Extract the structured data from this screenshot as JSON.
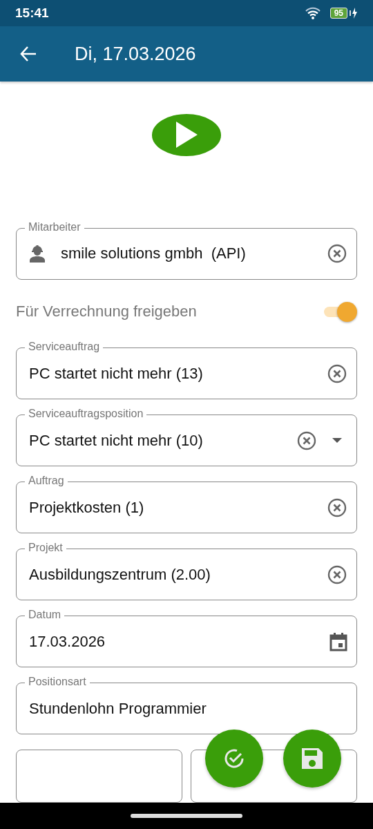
{
  "status_bar": {
    "time": "15:41",
    "battery": "95"
  },
  "app_bar": {
    "title": "Di, 17.03.2026"
  },
  "employee": {
    "label": "Mitarbeiter",
    "value": "smile solutions gmbh  (API)",
    "kind": "person"
  },
  "release": {
    "label": "Für Verrechnung freigeben",
    "on": true
  },
  "fields": [
    {
      "label": "Serviceauftrag",
      "value": "PC startet nicht mehr (13)",
      "kind": "clearable"
    },
    {
      "label": "Serviceauftragsposition",
      "value": "PC startet nicht mehr (10)",
      "kind": "dropdown"
    },
    {
      "label": "Auftrag",
      "value": "Projektkosten (1)",
      "kind": "clearable"
    },
    {
      "label": "Projekt",
      "value": "Ausbildungszentrum (2.00)",
      "kind": "clearable"
    },
    {
      "label": "Datum",
      "value": "17.03.2026",
      "kind": "date"
    },
    {
      "label": "Positionsart",
      "value": "Stundenlohn Programmier",
      "kind": "text"
    }
  ]
}
